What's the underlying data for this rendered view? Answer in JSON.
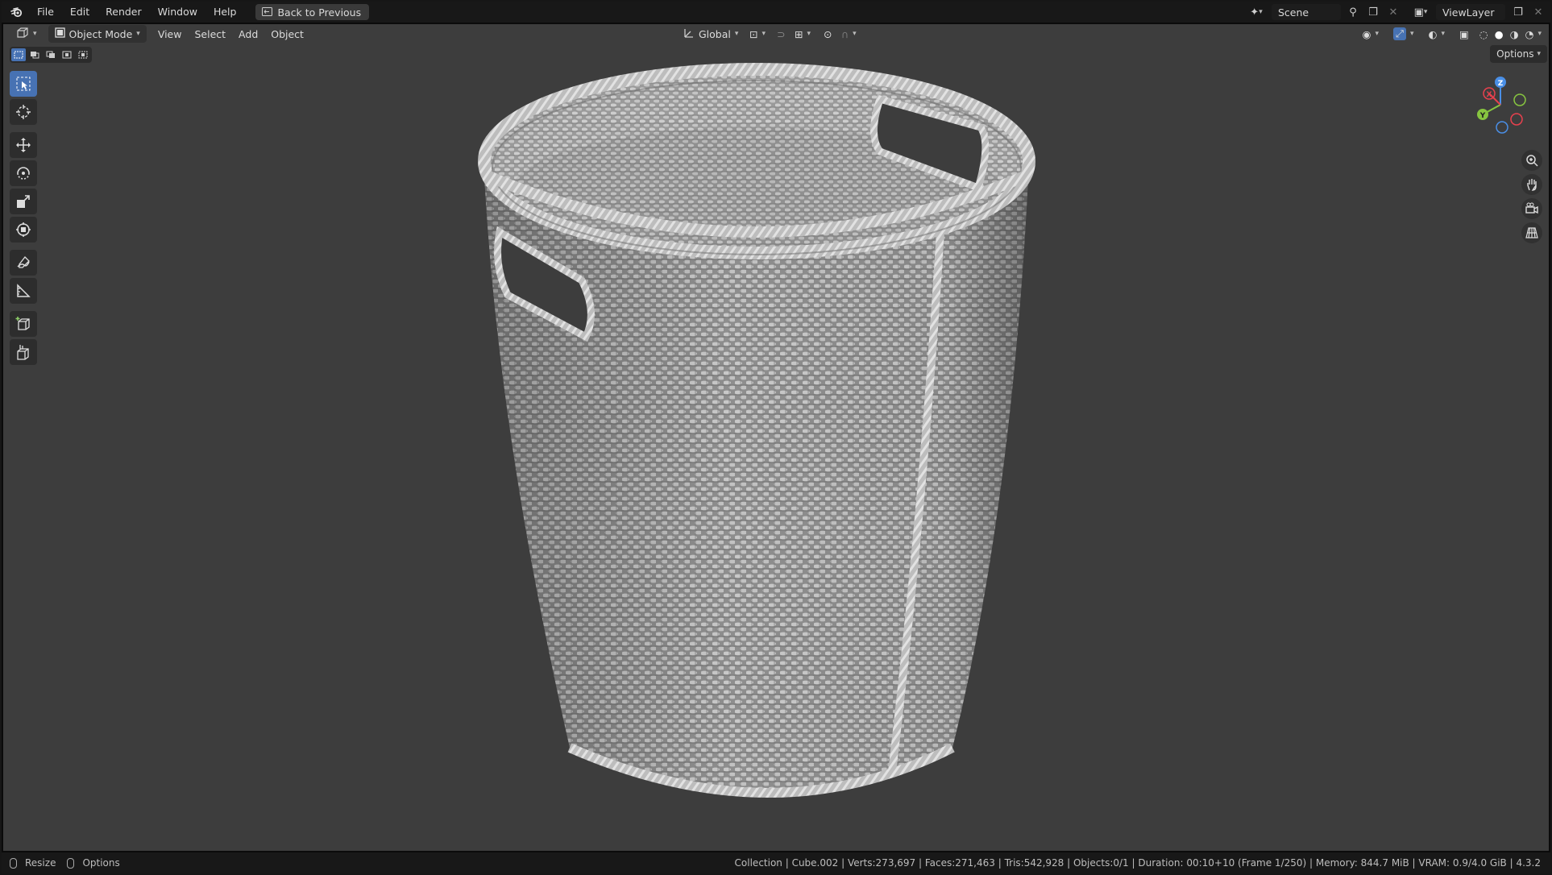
{
  "topbar": {
    "menus": [
      "File",
      "Edit",
      "Render",
      "Window",
      "Help"
    ],
    "back_button": "Back to Previous",
    "scene_name": "Scene",
    "view_layer": "ViewLayer"
  },
  "viewport_header": {
    "mode": "Object Mode",
    "menus": [
      "View",
      "Select",
      "Add",
      "Object"
    ],
    "orientation": "Global",
    "options_label": "Options"
  },
  "toolbar": {
    "tools": [
      "select-box",
      "cursor",
      "move",
      "rotate",
      "scale",
      "transform",
      "annotate",
      "measure",
      "add-cube",
      "extrude"
    ]
  },
  "gizmo": {
    "axes": [
      "X",
      "Y",
      "Z"
    ],
    "colors": {
      "x": "#e8414e",
      "y": "#87c540",
      "z": "#4a8fe6"
    }
  },
  "statusbar": {
    "left_resize": "Resize",
    "left_options": "Options",
    "info": "Collection | Cube.002 | Verts:273,697 | Faces:271,463 | Tris:542,928 | Objects:0/1 | Duration: 00:10+10 (Frame 1/250) | Memory: 844.7 MiB | VRAM: 0.9/4.0 GiB | 4.3.2"
  },
  "colors": {
    "viewport_bg": "#3d3d3d",
    "active_tool": "#4772b3",
    "bar_bg": "#181818"
  }
}
